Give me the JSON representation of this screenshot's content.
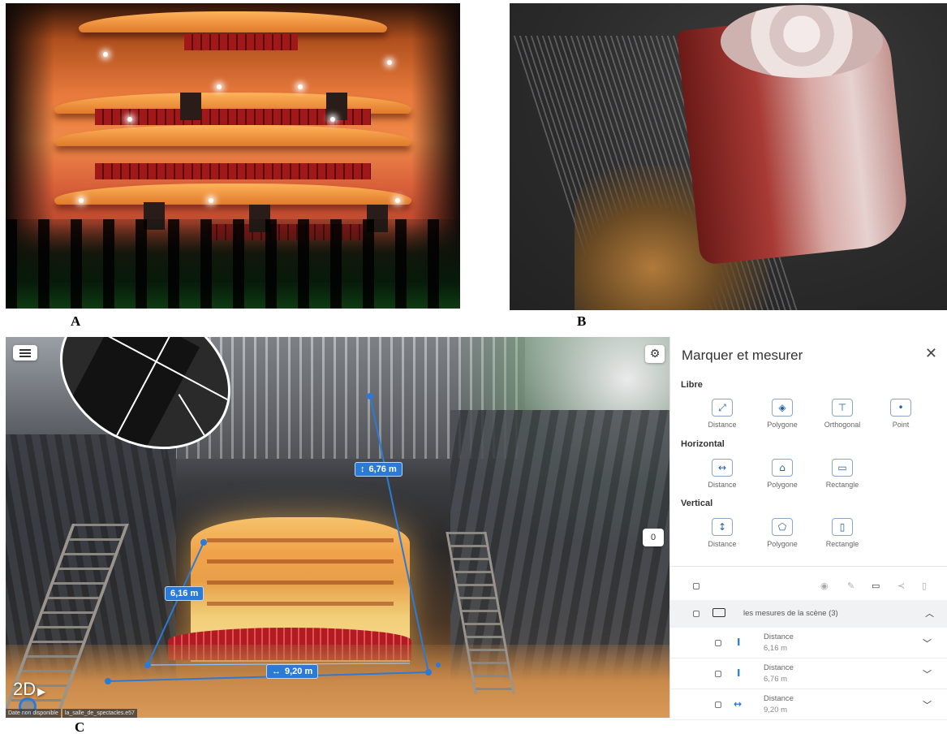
{
  "figure_labels": {
    "a": "A",
    "b": "B",
    "c": "C"
  },
  "viewer": {
    "view_mode": "2D",
    "zero_button": "0",
    "footer": [
      "Date non disponible",
      "la_salle_de_spectacles.e57"
    ],
    "measurements": {
      "height_1": "6,76 m",
      "height_2": "6,16 m",
      "width": "9,20 m"
    },
    "accent_color": "#2b7bd6"
  },
  "sidebar": {
    "title": "Marquer et mesurer",
    "sections": {
      "libre": {
        "title": "Libre",
        "tools": [
          "Distance",
          "Polygone",
          "Orthogonal",
          "Point"
        ]
      },
      "horizontal": {
        "title": "Horizontal",
        "tools": [
          "Distance",
          "Polygone",
          "Rectangle"
        ]
      },
      "vertical": {
        "title": "Vertical",
        "tools": [
          "Distance",
          "Polygone",
          "Rectangle"
        ]
      }
    },
    "group": {
      "name": "les mesures de la scène (3)",
      "items": [
        {
          "type": "Distance",
          "value": "6,16 m"
        },
        {
          "type": "Distance",
          "value": "6,76 m"
        },
        {
          "type": "Distance",
          "value": "9,20 m"
        }
      ]
    }
  }
}
